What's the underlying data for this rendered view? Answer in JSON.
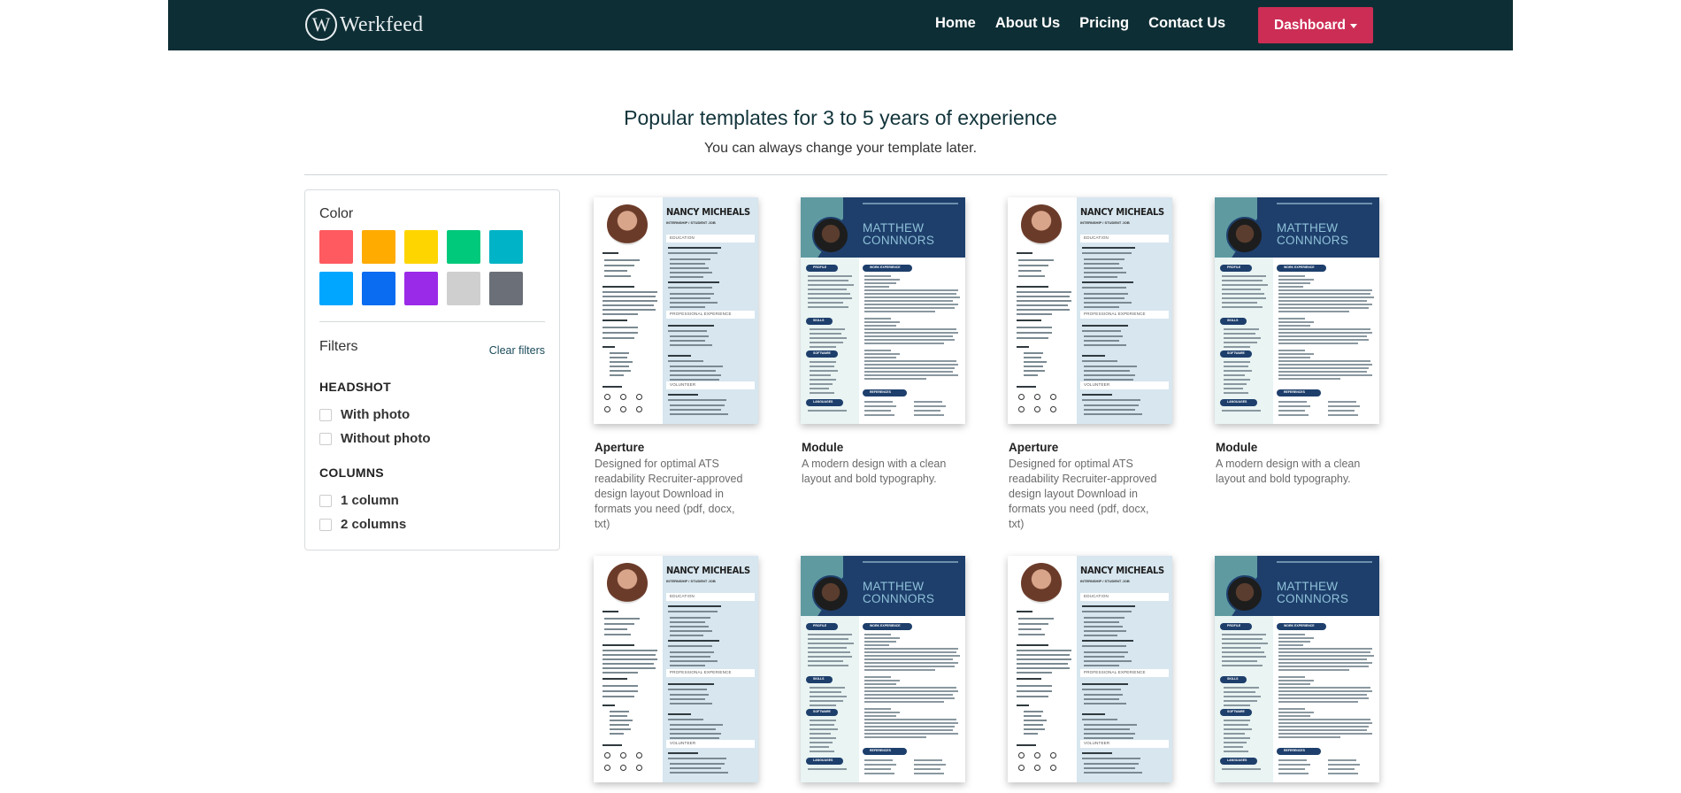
{
  "brand": {
    "logo_letter": "W",
    "name": "Werkfeed"
  },
  "nav": {
    "links": [
      "Home",
      "About Us",
      "Pricing",
      "Contact Us"
    ],
    "dashboard_label": "Dashboard"
  },
  "header": {
    "title": "Popular templates for 3 to 5 years of experience",
    "subtitle": "You can always change your template later."
  },
  "sidebar": {
    "color_label": "Color",
    "colors": [
      "#ff5a5f",
      "#ffab00",
      "#ffd500",
      "#00c97b",
      "#00b3c6",
      "#00a6ff",
      "#0a6cf0",
      "#9b2ae8",
      "#cfcfcf",
      "#6b7078"
    ],
    "filters_label": "Filters",
    "clear_filters": "Clear filters",
    "headshot_title": "HEADSHOT",
    "headshot_options": [
      "With photo",
      "Without photo"
    ],
    "columns_title": "COLUMNS",
    "columns_options": [
      "1 column",
      "2 columns"
    ]
  },
  "templates": [
    {
      "name": "Aperture",
      "desc": "Designed for optimal ATS readability Recruiter-approved design layout Download in formats you need (pdf, docx, txt)"
    },
    {
      "name": "Module",
      "desc": "A modern design with a clean layout and bold typography."
    },
    {
      "name": "Aperture",
      "desc": "Designed for optimal ATS readability Recruiter-approved design layout Download in formats you need (pdf, docx, txt)"
    },
    {
      "name": "Module",
      "desc": "A modern design with a clean layout and bold typography."
    }
  ],
  "resume_text": {
    "aperture_name": "NANCY MICHEALS",
    "aperture_role": "INTERNSHIP / STUDENT JOB",
    "aperture_sections": [
      "EDUCATION",
      "PROFESSIONAL EXPERIENCE",
      "VOLUNTEER"
    ],
    "module_name_1": "MATTHEW",
    "module_name_2": "CONNNORS",
    "module_pills": [
      "PROFILE",
      "WORK EXPERIENCE",
      "SKILLS",
      "SOFTWARE",
      "REFERENCES",
      "LANGUAGES"
    ]
  }
}
